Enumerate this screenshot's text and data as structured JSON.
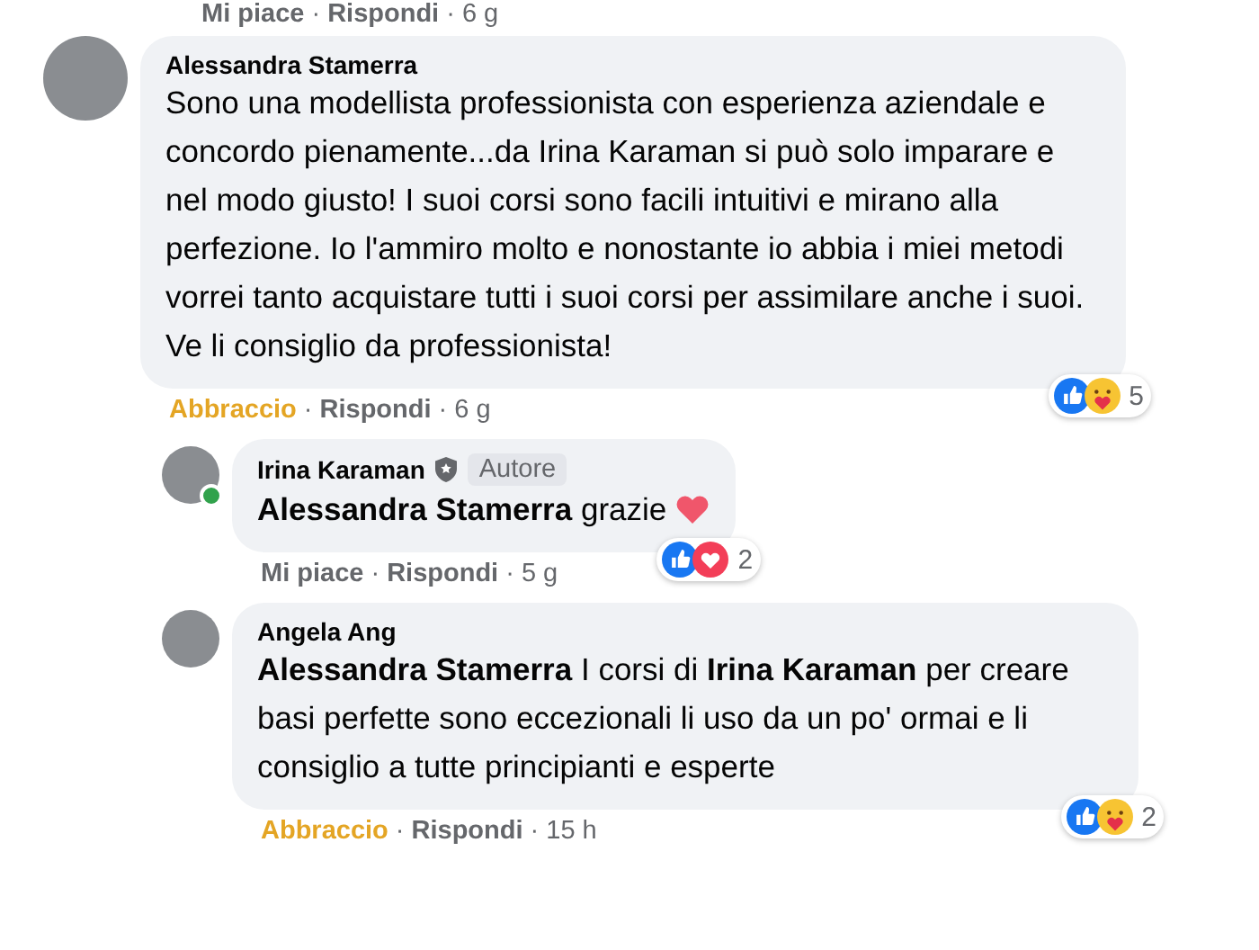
{
  "previous_actions": {
    "reaction_label": "Mi piace",
    "reacted": false,
    "separators": [
      "·",
      "·"
    ],
    "reply": "Rispondi",
    "time": "6 g"
  },
  "comments": [
    {
      "author": "Alessandra Stamerra",
      "text": "Sono una modellista professionista con esperienza aziendale e concordo pienamente...da Irina Karaman si può solo imparare e nel modo giusto! I suoi corsi sono facili intuitivi e mirano alla perfezione. Io l'ammiro molto e nonostante io abbia i miei metodi vorrei tanto acquistare tutti i suoi corsi per assimilare anche i suoi. Ve li consiglio da professionista!",
      "reactions": [
        {
          "kind": "like"
        },
        {
          "kind": "care"
        }
      ],
      "count": "5",
      "actions": {
        "reaction_label": "Abbraccio",
        "reacted": true,
        "separators": [
          "·",
          "·"
        ],
        "reply": "Rispondi",
        "time": "6 g"
      },
      "children": [
        {
          "author": "Irina Karaman",
          "badge": "Autore",
          "online": true,
          "text": "**Alessandra Stamerra** grazie",
          "emojis": [
            {
              "kind": "heart"
            }
          ],
          "reactions": [
            {
              "kind": "like"
            },
            {
              "kind": "love"
            }
          ],
          "count": "2",
          "actions": {
            "reaction_label": "Mi piace",
            "reacted": false,
            "separators": [
              "·",
              "·"
            ],
            "reply": "Rispondi",
            "time": "5 g"
          }
        },
        {
          "author": "Angela Ang",
          "text": "**Alessandra Stamerra** I corsi di **Irina Karaman** per creare basi perfette sono eccezionali li uso da un po' ormai e li consiglio a tutte principianti e esperte",
          "reactions": [
            {
              "kind": "like"
            },
            {
              "kind": "care"
            }
          ],
          "count": "2",
          "actions": {
            "reaction_label": "Abbraccio",
            "reacted": true,
            "separators": [
              "·",
              "·"
            ],
            "reply": "Rispondi",
            "time": "15 h"
          }
        }
      ]
    }
  ]
}
